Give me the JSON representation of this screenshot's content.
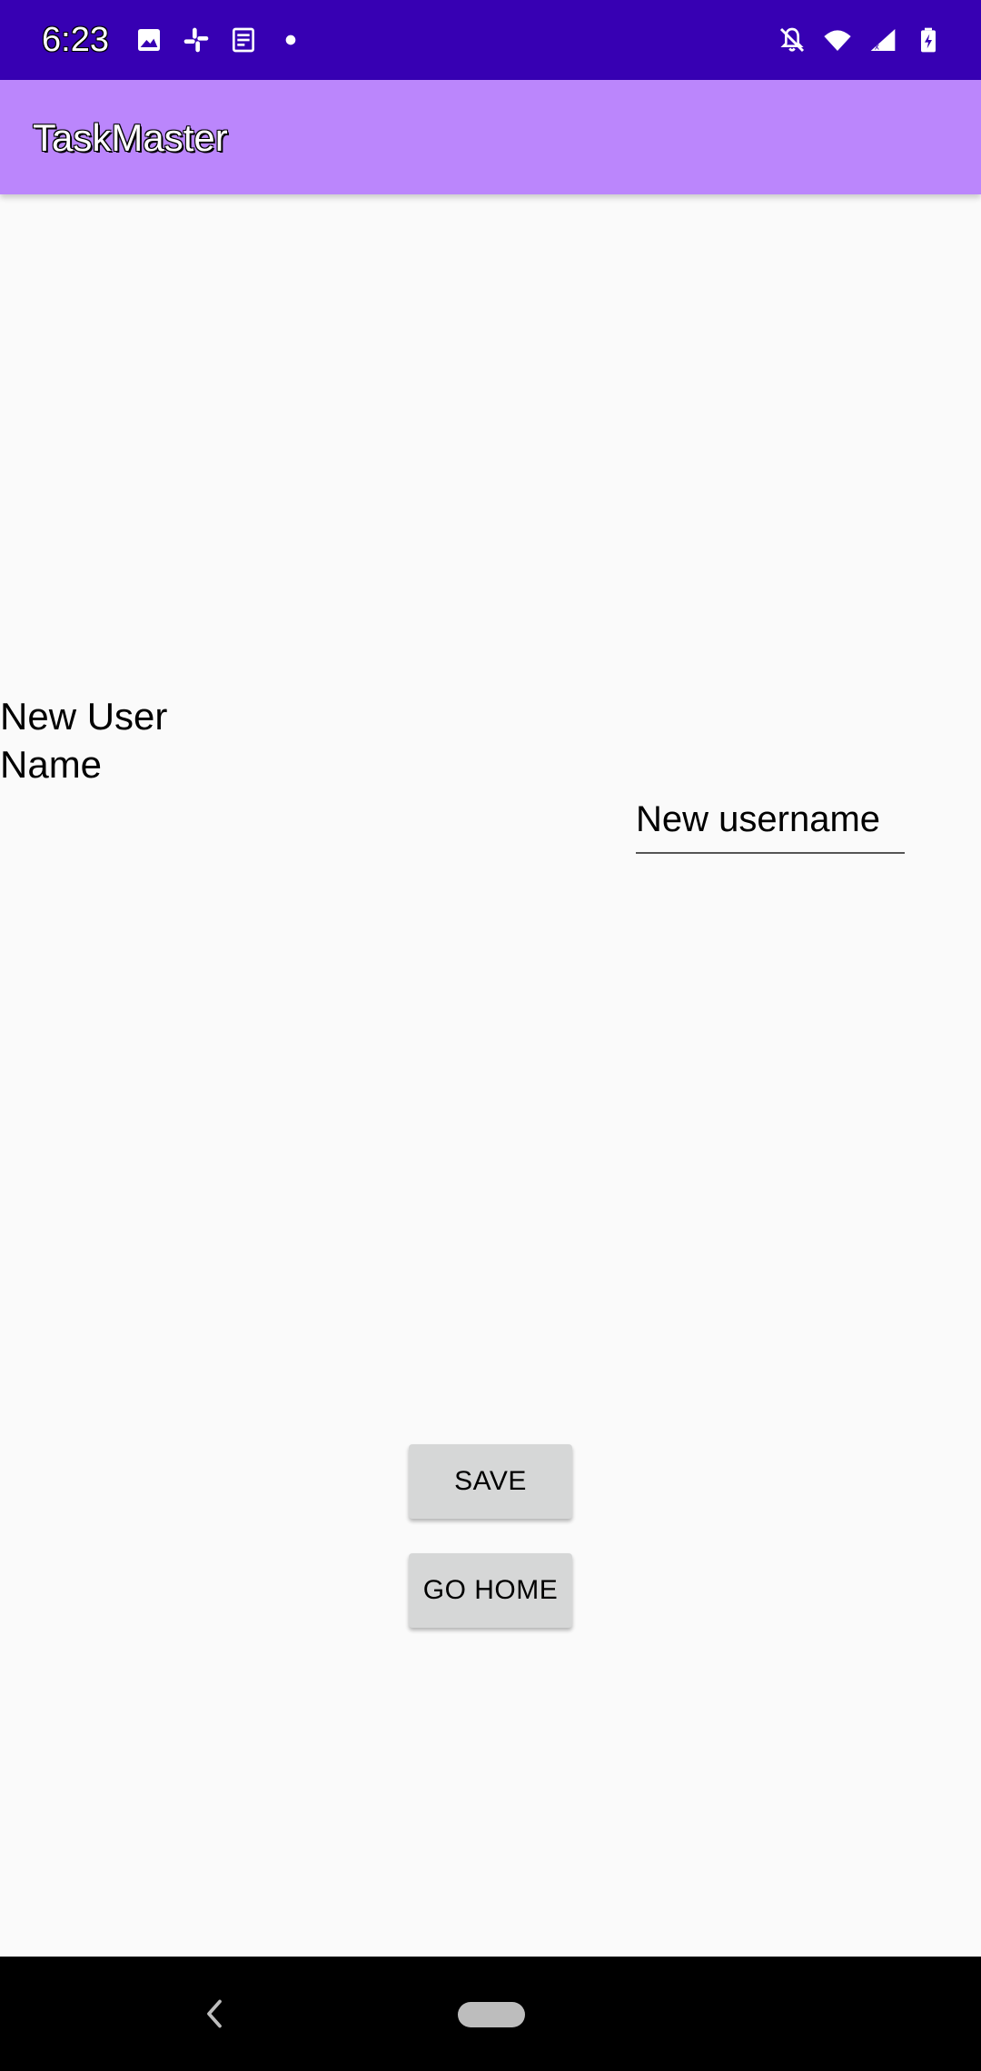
{
  "status_bar": {
    "time": "6:23",
    "left_icons": [
      "image-icon",
      "slack-icon",
      "news-icon",
      "dot-icon"
    ],
    "right_icons": [
      "notifications-off-icon",
      "wifi-icon",
      "signal-icon",
      "battery-charging-icon"
    ]
  },
  "app_bar": {
    "title": "TaskMaster",
    "color": "#BB86FC"
  },
  "form": {
    "label": "New User Name",
    "username_placeholder": "New username",
    "username_value": ""
  },
  "buttons": {
    "save_label": "SAVE",
    "home_label": "GO HOME"
  },
  "colors": {
    "status_bar": "#3700B3",
    "app_bar": "#BB86FC",
    "background": "#FAFAFA",
    "button": "#D6D7D7"
  },
  "nav_bar": {
    "back_icon": "back-icon",
    "home_icon": "home-pill-icon"
  }
}
